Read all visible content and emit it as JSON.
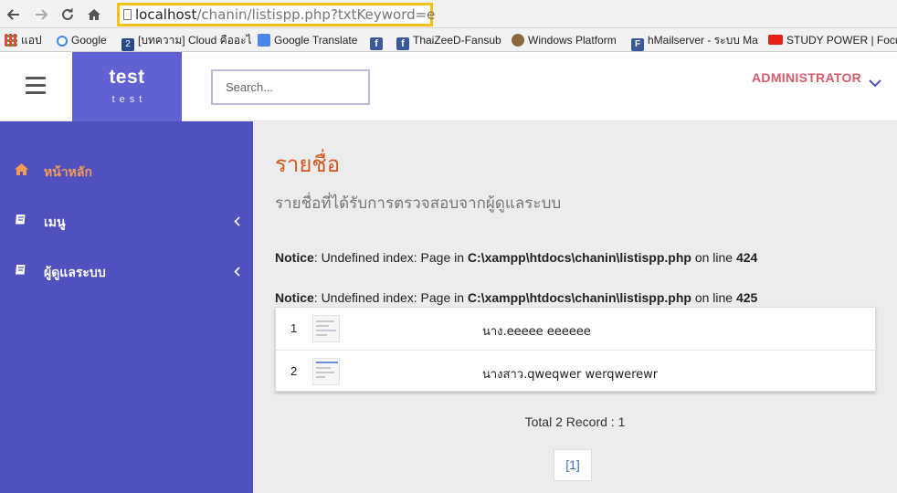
{
  "browser": {
    "url_host": "localhost",
    "url_rest": "/chanin/listispp.php?txtKeyword=e",
    "bookmarks": [
      {
        "label": "แอป",
        "icon": "apps-grid-icon",
        "color": "#888888"
      },
      {
        "label": "Google",
        "icon": "google-icon",
        "color": "#4285f4"
      },
      {
        "label": "[บทความ] Cloud คืออะไ",
        "icon": "bookmark-2-icon",
        "color": "#2b4a8b"
      },
      {
        "label": "Google Translate",
        "icon": "translate-icon",
        "color": "#4a86e8"
      },
      {
        "label": "",
        "icon": "facebook-icon",
        "color": "#3b5998"
      },
      {
        "label": "ThaiZeeD-Fansub",
        "icon": "facebook-icon",
        "color": "#3b5998"
      },
      {
        "label": "Windows Platform",
        "icon": "windows-platform-icon",
        "color": "#6a4a2a"
      },
      {
        "label": "hMailserver - ระบบ Ma",
        "icon": "facebook-f-icon",
        "color": "#3b5998"
      },
      {
        "label": "STUDY POWER | Focu",
        "icon": "youtube-icon",
        "color": "#e62117"
      }
    ]
  },
  "header": {
    "brand_title": "test",
    "brand_subtitle": "test",
    "search_placeholder": "Search...",
    "user_label": "ADMINISTRATOR"
  },
  "sidebar": {
    "items": [
      {
        "label": "หน้าหลัก",
        "icon": "home-icon",
        "active": true
      },
      {
        "label": "เมนู",
        "icon": "book-icon",
        "has_submenu": true
      },
      {
        "label": "ผู้ดูแลระบบ",
        "icon": "book-icon",
        "has_submenu": true
      }
    ]
  },
  "main": {
    "title": "รายชื่อ",
    "subtitle": "รายชื่อที่ได้รับการตรวจสอบจากผู้ดูแลระบบ",
    "notices": [
      {
        "label": "Notice",
        "message": ": Undefined index: Page in ",
        "path": "C:\\xampp\\htdocs\\chanin\\listispp.php",
        "on_line": " on line ",
        "line": "424"
      },
      {
        "label": "Notice",
        "message": ": Undefined index: Page in ",
        "path": "C:\\xampp\\htdocs\\chanin\\listispp.php",
        "on_line": " on line ",
        "line": "425"
      }
    ],
    "rows": [
      {
        "index": "1",
        "name": "นาง.eeeee  eeeeee"
      },
      {
        "index": "2",
        "name": "นางสาว.qweqwer  werqwerewr"
      }
    ],
    "total_text": "Total 2 Record : 1",
    "pager_label": "[1]"
  },
  "colors": {
    "sidebar_bg": "#5051be",
    "brand_bg": "#6161d3",
    "title": "#d35a1e",
    "active_item": "#f39b53",
    "admin": "#d55a6a",
    "highlight_box": "#f5c211"
  }
}
